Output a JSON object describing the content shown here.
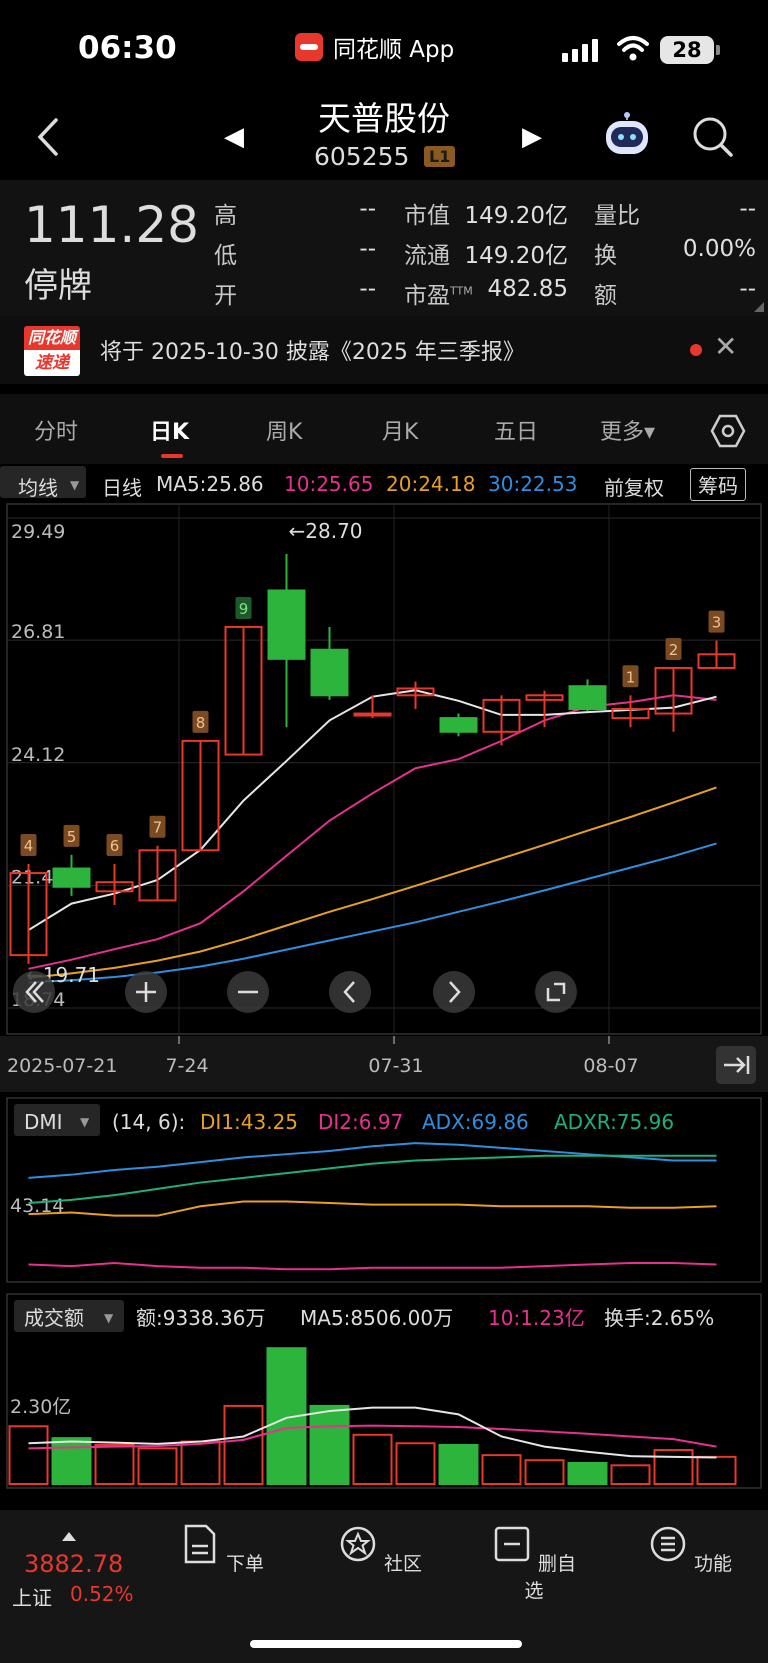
{
  "status": {
    "time": "06:30",
    "app_name": "同花顺 App",
    "battery": "28"
  },
  "nav": {
    "title": "天普股份",
    "code": "605255",
    "level": "L1"
  },
  "quote": {
    "price": "111.28",
    "state": "停牌",
    "rows": [
      {
        "label": "高",
        "value": "--",
        "label2": "市值",
        "value2": "149.20亿",
        "label3": "量比",
        "value3": "--"
      },
      {
        "label": "低",
        "value": "--",
        "label2": "流通",
        "value2": "149.20亿",
        "label3": "换",
        "value3": "0.00%"
      },
      {
        "label": "开",
        "value": "--",
        "label2": "市盈",
        "label2_sup": "TTM",
        "value2": "482.85",
        "label3": "额",
        "value3": "--"
      }
    ]
  },
  "news": {
    "badge_top": "同花顺",
    "badge_bottom": "速递",
    "text": "将于 2025-10-30 披露《2025 年三季报》"
  },
  "tabs": [
    "分时",
    "日K",
    "周K",
    "月K",
    "五日",
    "更多▾"
  ],
  "active_tab": 1,
  "ma_bar": {
    "selector": "均线",
    "period": "日线",
    "ma5": "MA5:25.86",
    "ma10": "10:25.65",
    "ma20": "20:24.18",
    "ma30": "30:22.53",
    "adjust": "前复权",
    "chip": "筹码"
  },
  "colors": {
    "up": "#e8372c",
    "down": "#2cb43c",
    "ma5": "#e6e6e6",
    "ma10": "#e6318f",
    "ma20": "#e8a022",
    "ma30": "#2e8fe0",
    "adxr": "#1fb07a"
  },
  "chart_data": [
    {
      "type": "candlestick",
      "y_ticks": [
        "29.49",
        "26.81",
        "24.12",
        "21.43",
        "18.74"
      ],
      "ylim": [
        18.74,
        29.49
      ],
      "x_tick_labels": [
        "2025-07-21",
        "7-24",
        "07-31",
        "08-07"
      ],
      "annotations": {
        "high": "←28.70",
        "low": "←19.71"
      },
      "candles": [
        {
          "o": 19.9,
          "h": 21.9,
          "l": 19.71,
          "c": 21.7,
          "tag": "4"
        },
        {
          "o": 21.8,
          "h": 22.1,
          "l": 21.2,
          "c": 21.4,
          "tag": "5"
        },
        {
          "o": 21.3,
          "h": 21.9,
          "l": 21.0,
          "c": 21.5,
          "tag": "6"
        },
        {
          "o": 21.1,
          "h": 22.3,
          "l": 21.1,
          "c": 22.2,
          "tag": "7"
        },
        {
          "o": 22.2,
          "h": 24.6,
          "l": 22.2,
          "c": 24.6,
          "tag": "8"
        },
        {
          "o": 24.3,
          "h": 27.1,
          "l": 24.3,
          "c": 27.1,
          "tag": "9"
        },
        {
          "o": 27.9,
          "h": 28.7,
          "l": 24.9,
          "c": 26.4,
          "tag": ""
        },
        {
          "o": 26.6,
          "h": 27.1,
          "l": 25.5,
          "c": 25.6,
          "tag": ""
        },
        {
          "o": 25.2,
          "h": 25.6,
          "l": 25.1,
          "c": 25.2,
          "tag": ""
        },
        {
          "o": 25.6,
          "h": 25.9,
          "l": 25.3,
          "c": 25.75,
          "tag": ""
        },
        {
          "o": 25.1,
          "h": 25.2,
          "l": 24.7,
          "c": 24.8,
          "tag": ""
        },
        {
          "o": 24.8,
          "h": 25.6,
          "l": 24.5,
          "c": 25.5,
          "tag": ""
        },
        {
          "o": 25.5,
          "h": 25.7,
          "l": 24.9,
          "c": 25.6,
          "tag": ""
        },
        {
          "o": 25.8,
          "h": 25.95,
          "l": 25.25,
          "c": 25.3,
          "tag": ""
        },
        {
          "o": 25.1,
          "h": 25.6,
          "l": 24.9,
          "c": 25.3,
          "tag": "1"
        },
        {
          "o": 25.2,
          "h": 26.2,
          "l": 24.8,
          "c": 26.2,
          "tag": "2"
        },
        {
          "o": 26.2,
          "h": 26.8,
          "l": 26.2,
          "c": 26.5,
          "tag": "3"
        }
      ],
      "ma5": [
        20.45,
        21.03,
        21.25,
        21.55,
        22.21,
        23.29,
        24.16,
        25.05,
        25.57,
        25.71,
        25.48,
        25.17,
        25.17,
        25.23,
        25.28,
        25.33,
        25.57
      ],
      "ma10": [
        19.6,
        19.8,
        20.03,
        20.25,
        20.6,
        21.3,
        22.08,
        22.85,
        23.45,
        24.0,
        24.2,
        24.6,
        25.05,
        25.35,
        25.45,
        25.6,
        25.5
      ],
      "ma20": [
        19.4,
        19.5,
        19.62,
        19.78,
        19.98,
        20.25,
        20.55,
        20.85,
        21.13,
        21.42,
        21.72,
        22.02,
        22.32,
        22.63,
        22.93,
        23.25,
        23.58
      ],
      "ma30": [
        19.3,
        19.35,
        19.42,
        19.52,
        19.65,
        19.82,
        20.02,
        20.22,
        20.42,
        20.62,
        20.85,
        21.08,
        21.32,
        21.57,
        21.82,
        22.07,
        22.35
      ]
    },
    {
      "type": "line",
      "title": "DMI",
      "params": "(14, 6):",
      "di1_label": "DI1:43.25",
      "di2_label": "DI2:6.97",
      "adx_label": "ADX:69.86",
      "adxr_label": "ADXR:75.96",
      "y_tick": "43.14",
      "ylim": [
        0,
        85
      ],
      "di1": [
        38,
        39,
        37,
        37,
        43,
        46,
        46,
        45,
        44,
        44,
        44,
        43,
        43,
        43,
        42,
        42,
        43
      ],
      "di2": [
        6,
        5,
        7,
        5,
        4,
        4,
        3,
        3,
        4,
        4,
        4,
        4,
        5,
        6,
        7,
        7,
        6
      ],
      "adx": [
        61,
        63,
        66,
        68,
        71,
        74,
        76,
        78,
        81,
        83,
        82,
        80,
        78,
        76,
        74,
        72,
        72
      ],
      "adxr": [
        45,
        47,
        50,
        54,
        58,
        61,
        64,
        67,
        70,
        72,
        73,
        74,
        75,
        75,
        75,
        75,
        75
      ]
    },
    {
      "type": "bar",
      "title": "成交额",
      "amount_label": "额:9338.36万",
      "ma5_label": "MA5:8506.00万",
      "ma10_label": "10:1.23亿",
      "turnover_label": "换手:2.65%",
      "y_tick": "2.30亿",
      "ylim": [
        0,
        4.3
      ],
      "values": [
        1.7,
        1.35,
        1.15,
        1.05,
        1.25,
        2.3,
        4.0,
        2.3,
        1.45,
        1.2,
        1.15,
        0.85,
        0.7,
        0.62,
        0.55,
        1.0,
        0.8
      ],
      "up": [
        true,
        false,
        true,
        true,
        true,
        true,
        false,
        false,
        true,
        true,
        false,
        true,
        true,
        false,
        true,
        true,
        true
      ],
      "ma5": [
        1.2,
        1.25,
        1.22,
        1.18,
        1.25,
        1.4,
        1.95,
        2.15,
        2.25,
        2.25,
        2.05,
        1.4,
        1.1,
        0.95,
        0.82,
        0.8,
        0.78
      ],
      "ma10": [
        1.05,
        1.08,
        1.1,
        1.12,
        1.18,
        1.3,
        1.65,
        1.7,
        1.72,
        1.7,
        1.68,
        1.62,
        1.55,
        1.48,
        1.4,
        1.32,
        1.1
      ]
    }
  ],
  "bottom": {
    "index_value": "3882.78",
    "index_name": "上证",
    "index_pct": "0.52%",
    "items": [
      "下单",
      "社区",
      "删自选",
      "功能"
    ]
  }
}
